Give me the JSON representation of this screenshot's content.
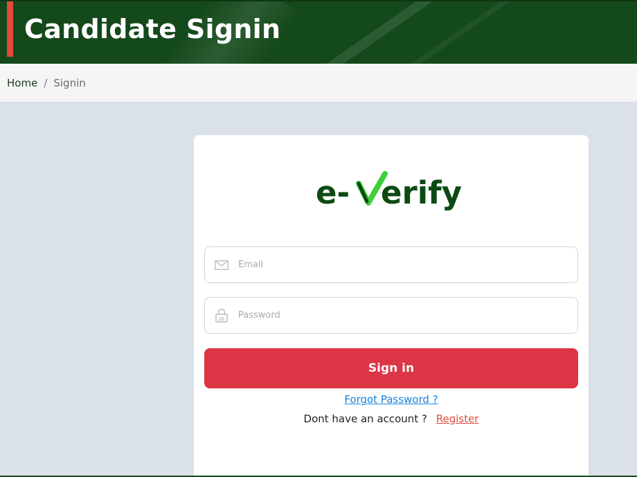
{
  "header": {
    "title": "Candidate Signin"
  },
  "breadcrumb": {
    "home": "Home",
    "separator": "/",
    "current": "Signin"
  },
  "logo": {
    "text_left": "e-",
    "text_right": "erify",
    "alt": "e-verify"
  },
  "form": {
    "email": {
      "placeholder": "Email",
      "value": "",
      "icon": "envelope-icon"
    },
    "password": {
      "placeholder": "Password",
      "value": "",
      "icon": "lock-icon"
    },
    "submit_label": "Sign in",
    "forgot_label": "Forgot Password ?",
    "no_account_text": "Dont have an account ?",
    "register_label": "Register"
  },
  "colors": {
    "header_bg": "#14491b",
    "accent_red": "#e24a3b",
    "button_red": "#dc3545",
    "link_blue": "#1a82d9",
    "page_bg": "#dbe1e9",
    "logo_dark": "#0c4a14",
    "logo_check": "#3fcf3a"
  }
}
